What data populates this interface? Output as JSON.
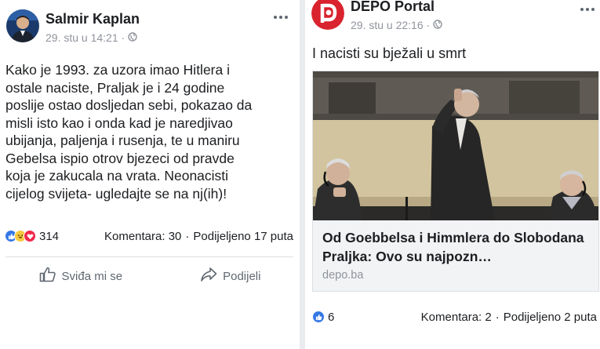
{
  "left_post": {
    "author": "Salmir Kaplan",
    "timestamp": "29. stu u 14:21",
    "separator": "·",
    "text": "Kako je 1993. za uzora imao Hitlera i\nostale naciste, Praljak je i 24 godine\nposlije ostao dosljedan sebi, pokazao da\nmisli isto kao i onda kad je naredjivao\nubijanja, paljenja i rusenja, te u maniru\nGebelsa ispio otrov bjezeci od pravde\nkoja je zakucala na vrata. Neonacisti\ncijelog svijeta- ugledajte se na nj(ih)!",
    "reaction_count": "314",
    "comments": "Komentara: 30",
    "shares": "Podijeljeno 17 puta",
    "like_label": "Sviđa mi se",
    "share_label": "Podijeli"
  },
  "right_post": {
    "author": "DEPO Portal",
    "timestamp": "29. stu u 22:16",
    "separator": "·",
    "text": "I nacisti su bježali u smrt",
    "link_title": "Od Goebbelsa i Himmlera do Slobodana Praljka: Ovo su najpozn…",
    "link_domain": "depo.ba",
    "reaction_count": "6",
    "comments": "Komentara: 2",
    "shares": "Podijeljeno 2 puta"
  },
  "colors": {
    "facebook_blue": "#3578e5",
    "depo_red": "#d9232e",
    "meta_gray": "#90949c"
  },
  "icons": [
    "more-icon",
    "globe-icon",
    "like-reaction-icon",
    "haha-reaction-icon",
    "love-reaction-icon",
    "thumbs-up-icon",
    "share-arrow-icon"
  ]
}
